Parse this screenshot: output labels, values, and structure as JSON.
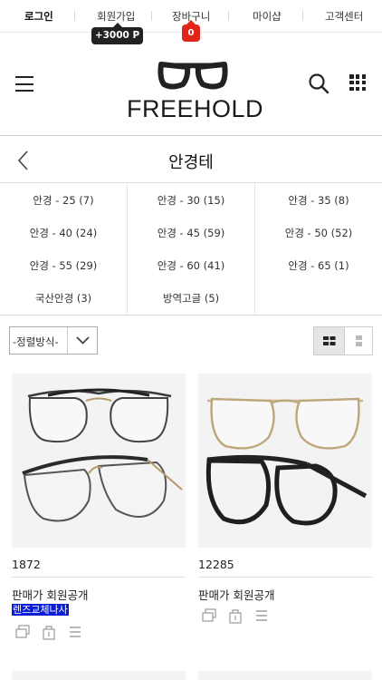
{
  "top_nav": {
    "items": [
      "로그인",
      "회원가입",
      "장바구니",
      "마이샵",
      "고객센터"
    ],
    "point_badge": "+3000 P",
    "cart_count": "0"
  },
  "header": {
    "logo_text": "FREEHOLD"
  },
  "page": {
    "title": "안경테"
  },
  "categories": [
    "안경 - 25 (7)",
    "안경 - 30 (15)",
    "안경 - 35 (8)",
    "안경 - 40 (24)",
    "안경 - 45 (59)",
    "안경 - 50 (52)",
    "안경 - 55 (29)",
    "안경 - 60 (41)",
    "안경 - 65 (1)",
    "국산안경 (3)",
    "방역고글 (5)"
  ],
  "toolbar": {
    "sort_label": "-정렬방식-"
  },
  "products": [
    {
      "name": "1872",
      "price": "판매가 회원공개",
      "tag": "렌즈교체나사"
    },
    {
      "name": "12285",
      "price": "판매가 회원공개",
      "tag": ""
    }
  ],
  "colors": {
    "accent_badge": "#e1251b",
    "tag_background": "#0a1ed6"
  },
  "icons": [
    "menu-icon",
    "search-icon",
    "apps-grid-icon",
    "chevron-left-icon",
    "chevron-down-icon",
    "grid-view-icon",
    "list-view-icon",
    "compare-icon",
    "shopping-bag-icon",
    "list-icon"
  ]
}
